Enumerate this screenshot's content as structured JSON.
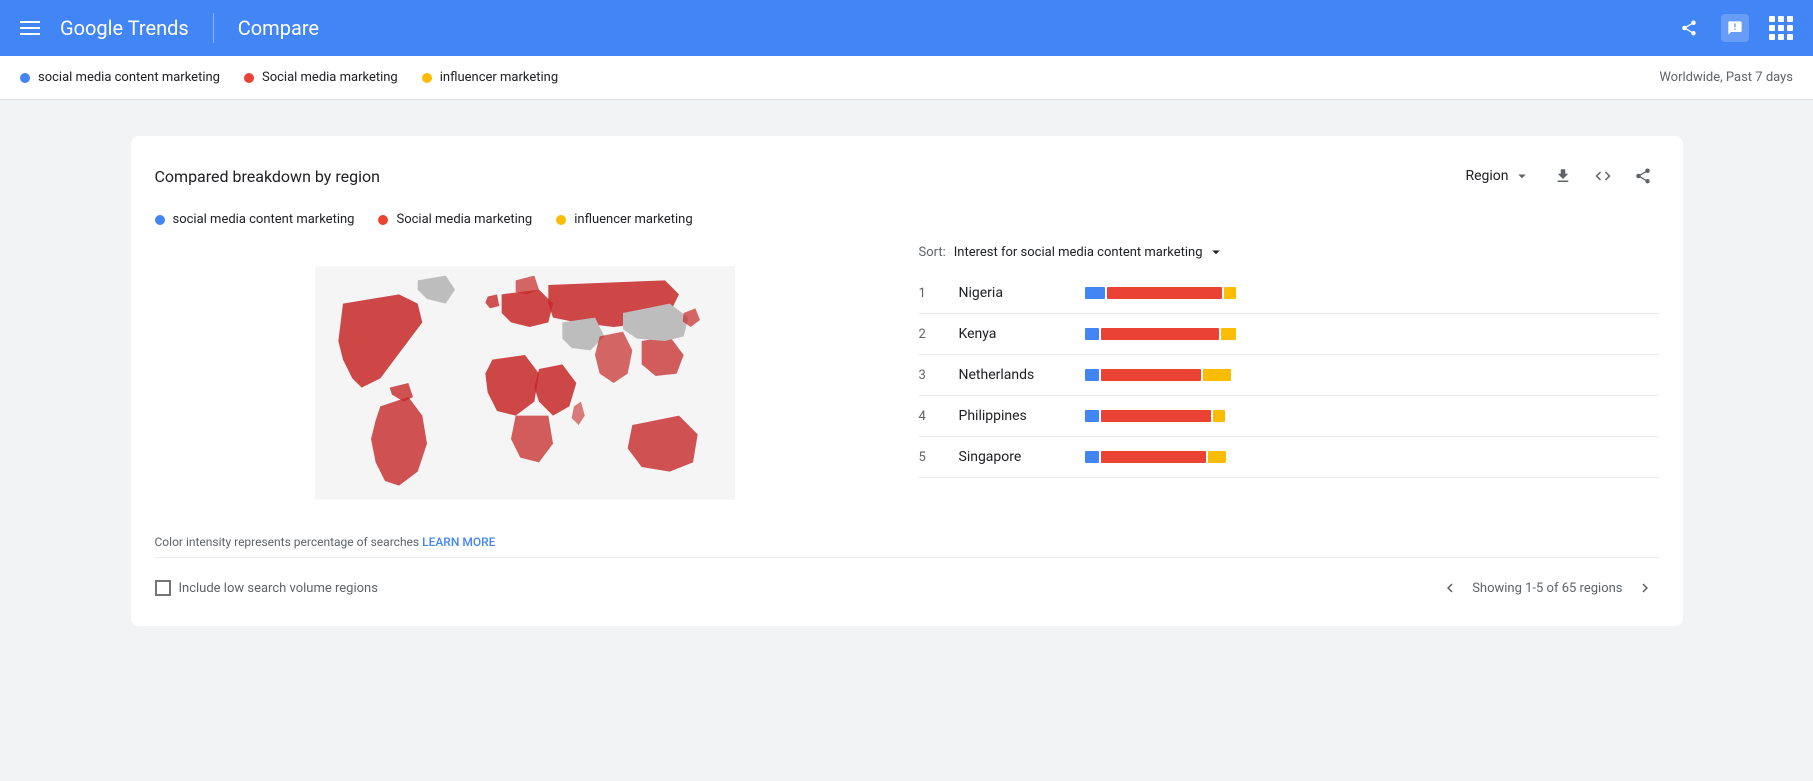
{
  "header": {
    "menu_label": "Menu",
    "logo_text": "Google Trends",
    "compare_label": "Compare",
    "share_label": "Share",
    "feedback_label": "Send feedback",
    "apps_label": "Apps"
  },
  "legend_bar": {
    "items": [
      {
        "label": "social media content marketing",
        "color": "#4285f4"
      },
      {
        "label": "Social media marketing",
        "color": "#ea4335"
      },
      {
        "label": "influencer marketing",
        "color": "#fbbc04"
      }
    ],
    "filter": "Worldwide, Past 7 days"
  },
  "card": {
    "title": "Compared breakdown by region",
    "region_label": "Region",
    "legend": [
      {
        "label": "social media content marketing",
        "color": "#4285f4"
      },
      {
        "label": "Social media marketing",
        "color": "#ea4335"
      },
      {
        "label": "influencer marketing",
        "color": "#fbbc04"
      }
    ],
    "map_note": "Color intensity represents percentage of searches",
    "learn_more": "LEARN MORE",
    "sort_label": "Sort:",
    "sort_value": "Interest for social media content marketing",
    "rows": [
      {
        "rank": "1",
        "country": "Nigeria",
        "blue": 20,
        "red": 115,
        "yellow": 12
      },
      {
        "rank": "2",
        "country": "Kenya",
        "blue": 14,
        "red": 118,
        "yellow": 15
      },
      {
        "rank": "3",
        "country": "Netherlands",
        "blue": 14,
        "red": 100,
        "yellow": 28
      },
      {
        "rank": "4",
        "country": "Philippines",
        "blue": 14,
        "red": 110,
        "yellow": 12
      },
      {
        "rank": "5",
        "country": "Singapore",
        "blue": 14,
        "red": 105,
        "yellow": 18
      }
    ],
    "footer": {
      "checkbox_label": "Include low search volume regions",
      "pagination_text": "Showing 1-5 of 65 regions"
    }
  },
  "colors": {
    "blue": "#4285f4",
    "red": "#ea4335",
    "yellow": "#fbbc04"
  }
}
